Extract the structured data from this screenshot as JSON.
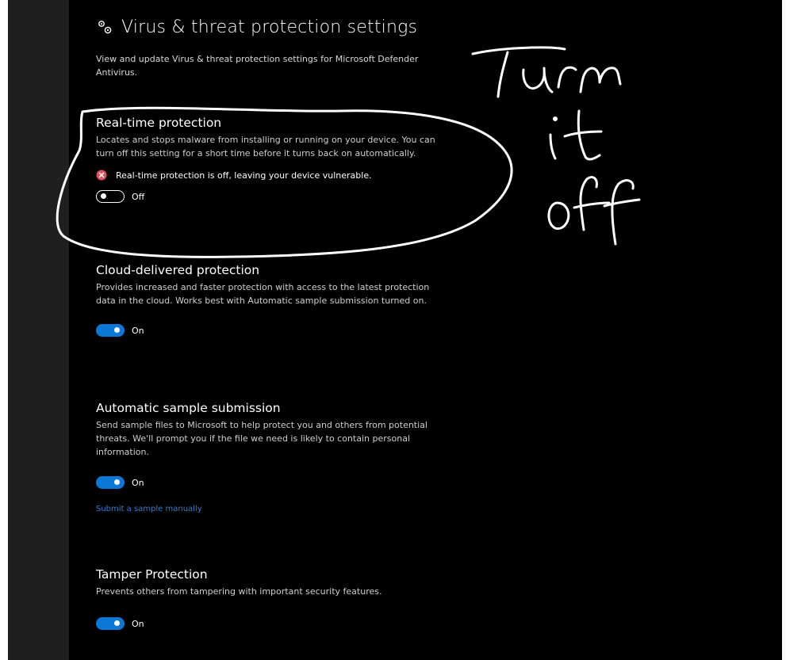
{
  "header": {
    "title": "Virus & threat protection settings",
    "icon": "gear-icon",
    "description": "View and update Virus & threat protection settings for Microsoft Defender Antivirus."
  },
  "sections": {
    "realtime": {
      "title": "Real-time protection",
      "description": "Locates and stops malware from installing or running on your device. You can turn off this setting for a short time before it turns back on automatically.",
      "warning": "Real-time protection is off, leaving your device vulnerable.",
      "toggle_label": "Off",
      "toggle_state": "off"
    },
    "cloud": {
      "title": "Cloud-delivered protection",
      "description": "Provides increased and faster protection with access to the latest protection data in the cloud. Works best with Automatic sample submission turned on.",
      "toggle_label": "On",
      "toggle_state": "on"
    },
    "sample": {
      "title": "Automatic sample submission",
      "description": "Send sample files to Microsoft to help protect you and others from potential threats. We'll prompt you if the file we need is likely to contain personal information.",
      "toggle_label": "On",
      "toggle_state": "on",
      "link": "Submit a sample manually"
    },
    "tamper": {
      "title": "Tamper Protection",
      "description": "Prevents others from tampering with important security features.",
      "toggle_label": "On",
      "toggle_state": "on"
    }
  },
  "annotation": {
    "note": "Turn it off",
    "color": "#ffffff"
  },
  "colors": {
    "accent": "#0a78d7",
    "error": "#e0505a",
    "link": "#2e7fd3"
  }
}
